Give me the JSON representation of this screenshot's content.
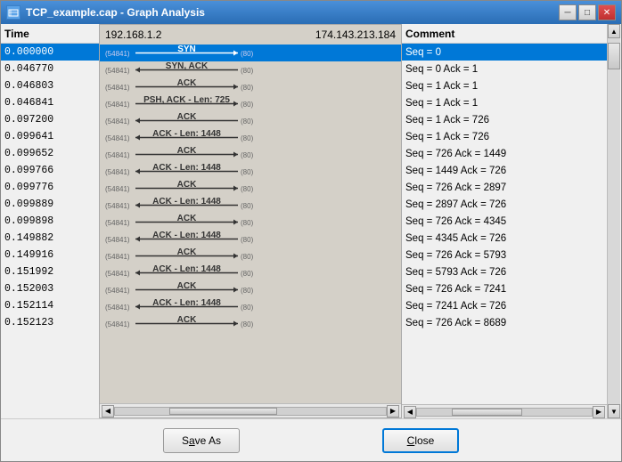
{
  "window": {
    "title": "TCP_example.cap - Graph Analysis",
    "icon": "📊"
  },
  "title_bar": {
    "min_label": "─",
    "max_label": "□",
    "close_label": "✕"
  },
  "header": {
    "ip_left": "192.168.1.2",
    "ip_right": "174.143.213.184",
    "time_col": "Time",
    "comment_col": "Comment"
  },
  "rows": [
    {
      "time": "0.000000",
      "arrow": "SYN",
      "direction": "right",
      "port_left": "(54841)",
      "port_right": "(80)",
      "comment": "Seq = 0",
      "selected": true
    },
    {
      "time": "0.046770",
      "arrow": "SYN, ACK",
      "direction": "left",
      "port_left": "(54841)",
      "port_right": "(80)",
      "comment": "Seq = 0 Ack = 1",
      "selected": false
    },
    {
      "time": "0.046803",
      "arrow": "ACK",
      "direction": "right",
      "port_left": "(54841)",
      "port_right": "(80)",
      "comment": "Seq = 1 Ack = 1",
      "selected": false
    },
    {
      "time": "0.046841",
      "arrow": "PSH, ACK - Len: 725",
      "direction": "right",
      "port_left": "(54841)",
      "port_right": "(80)",
      "comment": "Seq = 1 Ack = 1",
      "selected": false
    },
    {
      "time": "0.097200",
      "arrow": "ACK",
      "direction": "left",
      "port_left": "(54841)",
      "port_right": "(80)",
      "comment": "Seq = 1 Ack = 726",
      "selected": false
    },
    {
      "time": "0.099641",
      "arrow": "ACK - Len: 1448",
      "direction": "left",
      "port_left": "(54841)",
      "port_right": "(80)",
      "comment": "Seq = 1 Ack = 726",
      "selected": false
    },
    {
      "time": "0.099652",
      "arrow": "ACK",
      "direction": "right",
      "port_left": "(54841)",
      "port_right": "(80)",
      "comment": "Seq = 726 Ack = 1449",
      "selected": false
    },
    {
      "time": "0.099766",
      "arrow": "ACK - Len: 1448",
      "direction": "left",
      "port_left": "(54841)",
      "port_right": "(80)",
      "comment": "Seq = 1449 Ack = 726",
      "selected": false
    },
    {
      "time": "0.099776",
      "arrow": "ACK",
      "direction": "right",
      "port_left": "(54841)",
      "port_right": "(80)",
      "comment": "Seq = 726 Ack = 2897",
      "selected": false
    },
    {
      "time": "0.099889",
      "arrow": "ACK - Len: 1448",
      "direction": "left",
      "port_left": "(54841)",
      "port_right": "(80)",
      "comment": "Seq = 2897 Ack = 726",
      "selected": false
    },
    {
      "time": "0.099898",
      "arrow": "ACK",
      "direction": "right",
      "port_left": "(54841)",
      "port_right": "(80)",
      "comment": "Seq = 726 Ack = 4345",
      "selected": false
    },
    {
      "time": "0.149882",
      "arrow": "ACK - Len: 1448",
      "direction": "left",
      "port_left": "(54841)",
      "port_right": "(80)",
      "comment": "Seq = 4345 Ack = 726",
      "selected": false
    },
    {
      "time": "0.149916",
      "arrow": "ACK",
      "direction": "right",
      "port_left": "(54841)",
      "port_right": "(80)",
      "comment": "Seq = 726 Ack = 5793",
      "selected": false
    },
    {
      "time": "0.151992",
      "arrow": "ACK - Len: 1448",
      "direction": "left",
      "port_left": "(54841)",
      "port_right": "(80)",
      "comment": "Seq = 5793 Ack = 726",
      "selected": false
    },
    {
      "time": "0.152003",
      "arrow": "ACK",
      "direction": "right",
      "port_left": "(54841)",
      "port_right": "(80)",
      "comment": "Seq = 726 Ack = 7241",
      "selected": false
    },
    {
      "time": "0.152114",
      "arrow": "ACK - Len: 1448",
      "direction": "left",
      "port_left": "(54841)",
      "port_right": "(80)",
      "comment": "Seq = 7241 Ack = 726",
      "selected": false
    },
    {
      "time": "0.152123",
      "arrow": "ACK",
      "direction": "right",
      "port_left": "(54841)",
      "port_right": "(80)",
      "comment": "Seq = 726 Ack = 8689",
      "selected": false
    }
  ],
  "buttons": {
    "save_as": "Save As",
    "close": "Close"
  },
  "save_as_underline_char": "A",
  "close_underline_char": "C"
}
